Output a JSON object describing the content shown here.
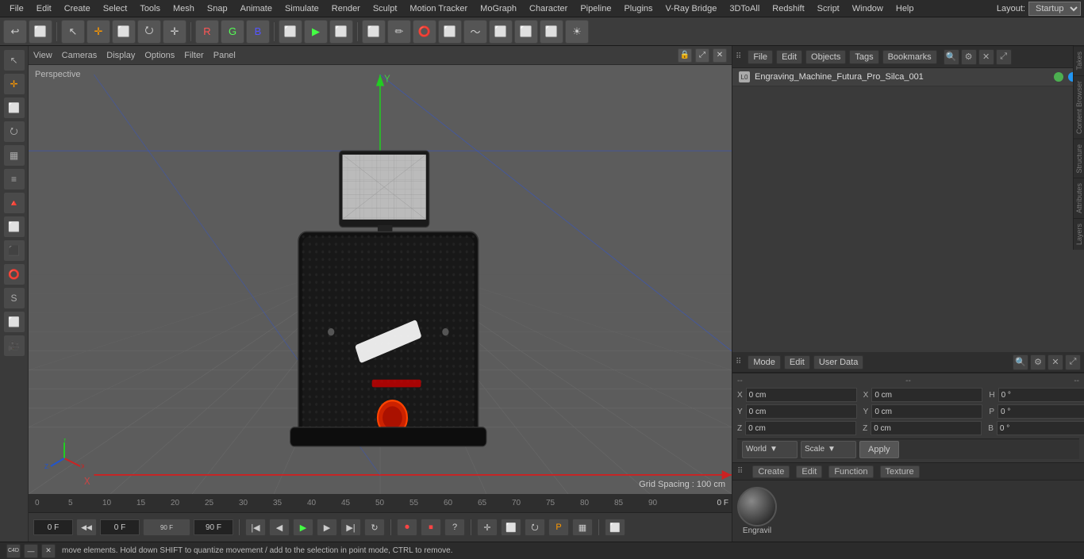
{
  "menubar": {
    "items": [
      "File",
      "Edit",
      "Create",
      "Select",
      "Tools",
      "Mesh",
      "Snap",
      "Animate",
      "Simulate",
      "Render",
      "Sculpt",
      "Motion Tracker",
      "MoGraph",
      "Character",
      "Pipeline",
      "Plugins",
      "V-Ray Bridge",
      "3DToAll",
      "Redshift",
      "Script",
      "Window",
      "Help"
    ],
    "layout_label": "Layout:",
    "layout_value": "Startup"
  },
  "toolbar": {
    "buttons": [
      "↩",
      "⬜",
      "↖",
      "✛",
      "⬜",
      "⭮",
      "✛",
      "R",
      "G",
      "B",
      "⬜",
      "▶",
      "⬜",
      "⬜",
      "⬜",
      "⬜",
      "⬜",
      "⬜",
      "⬜",
      "⬜",
      "⬜",
      "⬜",
      "☀"
    ]
  },
  "left_sidebar": {
    "buttons": [
      "⬜",
      "✛",
      "⬜",
      "⭮",
      "☰",
      "⬜",
      "🔺",
      "⬜",
      "⬜",
      "⭕",
      "S",
      "⬜",
      "⬜"
    ]
  },
  "viewport": {
    "perspective_label": "Perspective",
    "grid_spacing": "Grid Spacing : 100 cm",
    "menus": [
      "View",
      "Cameras",
      "Display",
      "Options",
      "Filter",
      "Panel"
    ]
  },
  "timeline": {
    "marks": [
      "0",
      "5",
      "10",
      "15",
      "20",
      "25",
      "30",
      "35",
      "40",
      "45",
      "50",
      "55",
      "60",
      "65",
      "70",
      "75",
      "80",
      "85",
      "90"
    ],
    "frame_current": "0 F",
    "frame_start": "0 F",
    "frame_end_field1": "90 F",
    "frame_end_field2": "90 F",
    "frame_indicator": "0 F"
  },
  "object_manager": {
    "file_btn": "File",
    "edit_btn": "Edit",
    "view_btn": "Objects",
    "tags_btn": "Tags",
    "bookmarks_btn": "Bookmarks",
    "object_name": "Engraving_Machine_Futura_Pro_Silca_001",
    "object_icon": "L0"
  },
  "attributes": {
    "mode_btn": "Mode",
    "edit_btn": "Edit",
    "user_data_btn": "User Data",
    "dash1": "--",
    "dash2": "--",
    "dash3": "--"
  },
  "coord_fields": {
    "x_label": "X",
    "y_label": "Y",
    "z_label": "Z",
    "h_label": "H",
    "p_label": "P",
    "b_label": "B",
    "x_pos": "0 cm",
    "y_pos": "0 cm",
    "z_pos": "0 cm",
    "h_rot": "0 °",
    "p_rot": "0 °",
    "b_rot": "0 °",
    "sx_label": "X",
    "sy_label": "Y",
    "sz_label": "Z",
    "x_scale": "0 cm",
    "y_scale": "0 cm",
    "z_scale": "0 cm"
  },
  "bottom_bar": {
    "world_label": "World",
    "scale_label": "Scale",
    "apply_label": "Apply"
  },
  "material_panel": {
    "create_btn": "Create",
    "edit_btn": "Edit",
    "function_btn": "Function",
    "texture_btn": "Texture",
    "material_name": "Engravil"
  },
  "vertical_tabs": {
    "takes": "Takes",
    "content_browser": "Content Browser",
    "structure": "Structure",
    "attributes": "Attributes",
    "layers": "Layers"
  },
  "status_bar": {
    "message": "move elements. Hold down SHIFT to quantize movement / add to the selection in point mode, CTRL to remove."
  }
}
